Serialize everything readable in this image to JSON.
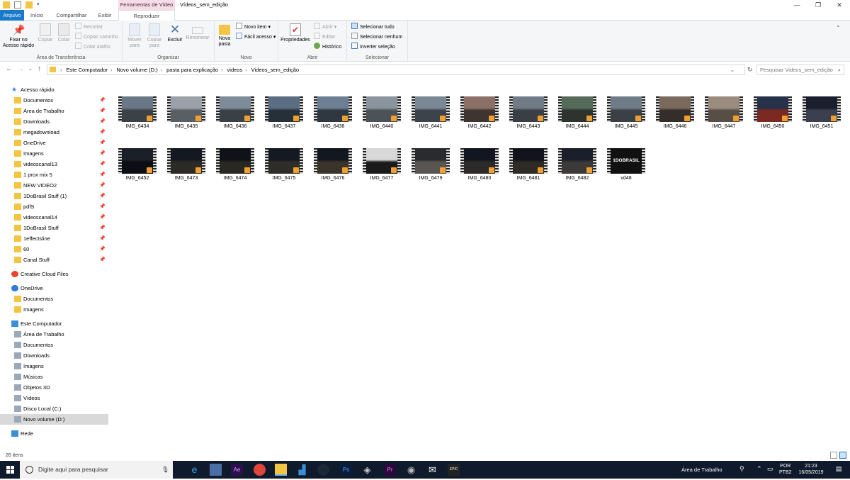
{
  "window": {
    "title": "Vídeos_sem_edição",
    "context_tab_title": "Ferramentas de Vídeo",
    "controls": [
      "—",
      "❐",
      "✕"
    ]
  },
  "tabs": [
    "Arquivo",
    "Início",
    "Compartilhar",
    "Exibir",
    "Reproduzir"
  ],
  "ribbon": {
    "clipboard": {
      "label": "Área de Transferência",
      "pin": "Fixar no\nAcesso rápido",
      "copy": "Copiar",
      "paste": "Colar",
      "cut": "Recortar",
      "copy_path": "Copiar caminho",
      "paste_shortcut": "Colar atalho"
    },
    "organize": {
      "label": "Organizar",
      "move_to": "Mover para",
      "copy_to": "Copiar para",
      "delete": "Excluir",
      "rename": "Renomear"
    },
    "new": {
      "label": "Novo",
      "new_folder": "Nova pasta",
      "new_item": "Novo item ▾",
      "easy_access": "Fácil acesso ▾"
    },
    "open": {
      "label": "Abrir",
      "properties": "Propriedades",
      "open": "Abrir ▾",
      "edit": "Editar",
      "history": "Histórico"
    },
    "select": {
      "label": "Selecionar",
      "select_all": "Selecionar tudo",
      "select_none": "Selecionar nenhum",
      "invert": "Inverter seleção"
    }
  },
  "address": {
    "crumbs": [
      "Este Computador",
      "Novo volume (D:)",
      "pasta para explicação",
      "videos",
      "Videos_sem_edição"
    ],
    "search_placeholder": "Pesquisar Videos_sem_edição"
  },
  "nav": {
    "quick_access": "Acesso rápido",
    "quick_items": [
      "Documentos",
      "Área de Trabalho",
      "Downloads",
      "megadownload",
      "OneDrive",
      "Imagens",
      "videoscanal13",
      "1 prox mix 5",
      "NEW VIDEO2",
      "1DoBrasil Stuff (1)",
      "pdfS",
      "videoscanal14",
      "1DoBrasil Stuff",
      "1effectsline",
      "60",
      "Canal Stuff"
    ],
    "creative_cloud": "Creative Cloud Files",
    "onedrive": "OneDrive",
    "onedrive_items": [
      "Documentos",
      "Imagens"
    ],
    "this_pc": "Este Computador",
    "pc_items": [
      "Área de Trabalho",
      "Documentos",
      "Downloads",
      "Imagens",
      "Músicas",
      "Objetos 3D",
      "Vídeos",
      "Disco Local (C:)",
      "Novo volume (D:)"
    ],
    "network": "Rede"
  },
  "files": [
    "IMG_6434",
    "IMG_6435",
    "IMG_6436",
    "IMG_6437",
    "IMG_6438",
    "IMG_6440",
    "IMG_6441",
    "IMG_6442",
    "IMG_6443",
    "IMG_6444",
    "IMG_6445",
    "IMG_6446",
    "IMG_6447",
    "IMG_6450",
    "IMG_6451",
    "IMG_6452",
    "IMG_6473",
    "IMG_6474",
    "IMG_6475",
    "IMG_6476",
    "IMG_6477",
    "IMG_6479",
    "IMG_6480",
    "IMG_6481",
    "IMG_6482",
    "vd48"
  ],
  "thumb_text": "1DOBRASIL",
  "status": "26 itens",
  "taskbar": {
    "search_placeholder": "Digite aqui para pesquisar",
    "desktop_label": "Área de Trabalho",
    "lang": "POR",
    "layout": "PTB2",
    "time": "21:23",
    "date": "16/05/2019"
  },
  "colors": {
    "accent": "#1979ca",
    "context_tab": "#f9dbe8",
    "taskbar": "#0f1a2c",
    "selected_nav": "#d9d9d9"
  }
}
